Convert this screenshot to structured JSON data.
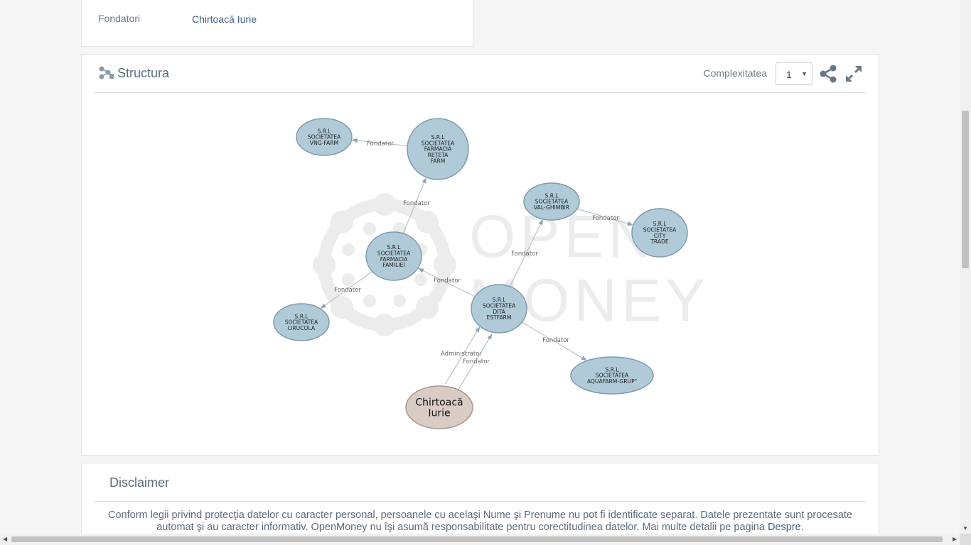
{
  "founders": {
    "label": "Fondatori",
    "value": "Chirtoacă Iurie"
  },
  "structure": {
    "title": "Structura",
    "complexity_label": "Complexitatea",
    "complexity_value": "1",
    "icons": {
      "title": "structure-icon",
      "share": "share-icon",
      "fullscreen": "expand-icon"
    },
    "watermark": [
      "OPEN",
      "MONEY"
    ],
    "graph": {
      "nodes": [
        {
          "id": "vng",
          "lines": [
            "S.R.L",
            "SOCIETATEA",
            "VNG-FARM"
          ],
          "kind": "company"
        },
        {
          "id": "reteta",
          "lines": [
            "S.R.L",
            "SOCIETATEA",
            "FARMACIA",
            "REŢETA",
            "FARM"
          ],
          "kind": "company"
        },
        {
          "id": "familiei",
          "lines": [
            "S.R.L",
            "SOCIETATEA",
            "FARMACIA",
            "FAMILIEI"
          ],
          "kind": "company"
        },
        {
          "id": "lirucola",
          "lines": [
            "S.R.L",
            "SOCIETATEA",
            "LIRUCOLA"
          ],
          "kind": "company"
        },
        {
          "id": "ghimbir",
          "lines": [
            "S.R.L",
            "SOCIETATEA",
            "VAL-GHIMBIR"
          ],
          "kind": "company"
        },
        {
          "id": "city",
          "lines": [
            "S.R.L",
            "SOCIETATEA",
            "CITY",
            "TRADE"
          ],
          "kind": "company"
        },
        {
          "id": "dita",
          "lines": [
            "S.R.L",
            "SOCIETATEA",
            "DITA",
            "ESTFARM"
          ],
          "kind": "company"
        },
        {
          "id": "aquafarm",
          "lines": [
            "S.R.L",
            "SOCIETATEA",
            "AQUAFARM-GRUP\""
          ],
          "kind": "company"
        },
        {
          "id": "person",
          "lines": [
            "Chirtoacă",
            "Iurie"
          ],
          "kind": "person"
        }
      ],
      "edges": [
        {
          "from": "reteta",
          "to": "vng",
          "label": "Fondator"
        },
        {
          "from": "familiei",
          "to": "reteta",
          "label": "Fondator"
        },
        {
          "from": "familiei",
          "to": "lirucola",
          "label": "Fondator"
        },
        {
          "from": "ghimbir",
          "to": "city",
          "label": "Fondator"
        },
        {
          "from": "dita",
          "to": "ghimbir",
          "label": "Fondator"
        },
        {
          "from": "dita",
          "to": "familiei",
          "label": "Fondator"
        },
        {
          "from": "dita",
          "to": "aquafarm",
          "label": "Fondator"
        },
        {
          "from": "person",
          "to": "dita",
          "label": "Administrator"
        },
        {
          "from": "person",
          "to": "dita",
          "label": "Fondator"
        }
      ]
    }
  },
  "disclaimer": {
    "title": "Disclaimer",
    "text": "Conform legii privind protecţia datelor cu caracter personal, persoanele cu acelaşi Nume şi Prenume nu pot fi identificate separat. Datele prezentate sunt procesate automat şi au caracter informativ. OpenMoney nu îşi asumă responsabilitate pentru corectitudinea datelor. Mai multe detalii pe pagina ",
    "link": "Despre."
  },
  "colors": {
    "company_fill": "#b0cad8",
    "company_stroke": "#7f9aae",
    "person_fill": "#d9ccc4",
    "person_stroke": "#a8988d",
    "edge": "#a9b8c4",
    "edge_label": "#666666",
    "watermark": "#ececec"
  }
}
